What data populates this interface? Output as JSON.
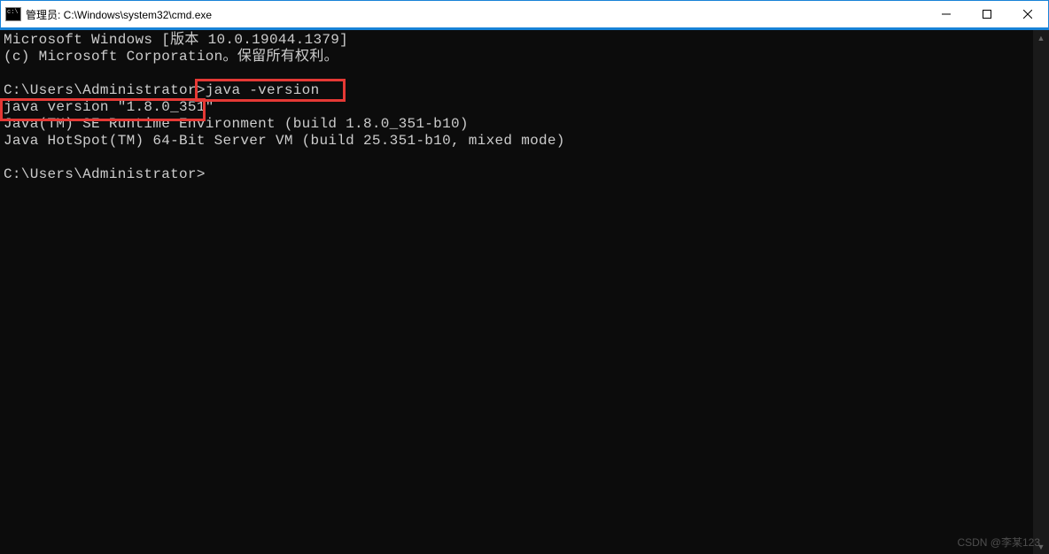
{
  "titlebar": {
    "title": "管理员: C:\\Windows\\system32\\cmd.exe"
  },
  "terminal": {
    "line1": "Microsoft Windows [版本 10.0.19044.1379]",
    "line2": "(c) Microsoft Corporation。保留所有权利。",
    "line3": "",
    "prompt1": "C:\\Users\\Administrator>",
    "command1": "java -version",
    "output1": "java version \"1.8.0_351\"",
    "output2": "Java(TM) SE Runtime Environment (build 1.8.0_351-b10)",
    "output3": "Java HotSpot(TM) 64-Bit Server VM (build 25.351-b10, mixed mode)",
    "prompt2": "C:\\Users\\Administrator>"
  },
  "watermark": "CSDN @李某123"
}
